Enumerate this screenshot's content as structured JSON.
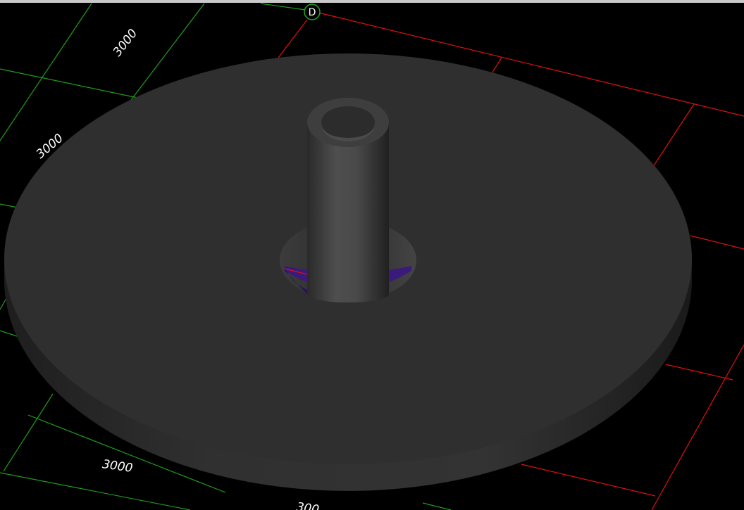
{
  "viewport": {
    "background": "#000000",
    "grid_colors": {
      "green": "#1e9e1e",
      "red": "#e01010"
    },
    "axis_marker": {
      "label": "D",
      "color": "#1fa81f"
    },
    "dimension_labels": [
      "3000",
      "3000",
      "3000",
      "300"
    ],
    "model": {
      "slab_color": "#2f2f2f",
      "column_color": "#4a4a4a",
      "opening_fill": "#3a1a7a"
    }
  }
}
